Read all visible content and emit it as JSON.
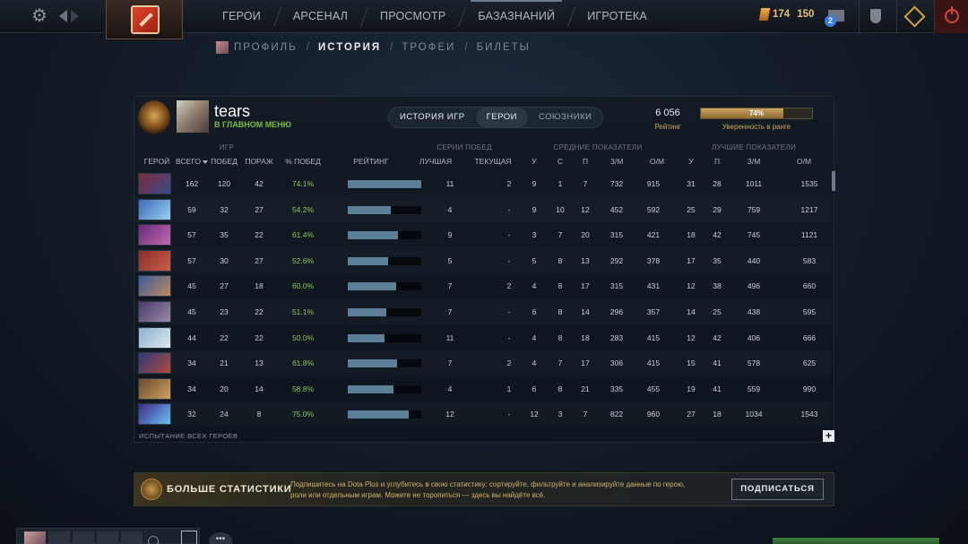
{
  "topbar": {
    "nav": [
      "ГЕРОИ",
      "АРСЕНАЛ",
      "ПРОСМОТР",
      "БАЗАЗНАНИЙ",
      "ИГРОТЕКА"
    ],
    "shards": "174",
    "shards2": "150",
    "mail_count": "2"
  },
  "subnav": {
    "items": [
      "ПРОФИЛЬ",
      "ИСТОРИЯ",
      "ТРОФЕИ",
      "БИЛЕТЫ"
    ],
    "active": "ИСТОРИЯ"
  },
  "profile": {
    "name": "tears",
    "status": "В ГЛАВНОМ МЕНЮ",
    "rating_value": "6 056",
    "rating_label": "Рейтинг",
    "confidence_value": "74%",
    "confidence_fraction": 0.74,
    "confidence_label": "Уверенность в ранге"
  },
  "tabs": [
    "ИСТОРИЯ ИГР",
    "ГЕРОИ",
    "СОЮЗНИКИ"
  ],
  "table": {
    "groups": {
      "games": "ИГР",
      "streaks": "СЕРИИ ПОБЕД",
      "averages": "СРЕДНИЕ ПОКАЗАТЕЛИ",
      "best": "ЛУЧШИЕ ПОКАЗАТЕЛИ"
    },
    "headers": {
      "hero": "ГЕРОЙ",
      "total": "ВСЕГО",
      "wins": "ПОБЕД",
      "losses": "ПОРАЖ",
      "winrate": "% ПОБЕД",
      "rating": "РЕЙТИНГ",
      "best": "ЛУЧШАЯ",
      "current": "ТЕКУЩАЯ",
      "avg_k": "У",
      "avg_d": "С",
      "avg_a": "П",
      "avg_gpm": "З/М",
      "avg_xpm": "О/М",
      "best_k": "У",
      "best_a": "П",
      "best_gpm": "З/М",
      "best_xpm": "О/М"
    },
    "rows": [
      {
        "total": "162",
        "wins": "120",
        "losses": "42",
        "winrate": "74.1%",
        "rating_fill": 1.0,
        "best": "11",
        "current": "2",
        "ak": "9",
        "ad": "1",
        "aa": "7",
        "agpm": "732",
        "axpm": "915",
        "bk": "31",
        "ba": "28",
        "bgpm": "1011",
        "bxpm": "1535",
        "colors": [
          "#7a2a3a",
          "#3a4a8a"
        ]
      },
      {
        "total": "59",
        "wins": "32",
        "losses": "27",
        "winrate": "54.2%",
        "rating_fill": 0.58,
        "best": "4",
        "current": "-",
        "ak": "9",
        "ad": "10",
        "aa": "12",
        "agpm": "452",
        "axpm": "592",
        "bk": "25",
        "ba": "29",
        "bgpm": "759",
        "bxpm": "1217",
        "colors": [
          "#3a6ab8",
          "#9ad0f0"
        ]
      },
      {
        "total": "57",
        "wins": "35",
        "losses": "22",
        "winrate": "61.4%",
        "rating_fill": 0.68,
        "best": "9",
        "current": "-",
        "ak": "3",
        "ad": "7",
        "aa": "20",
        "agpm": "315",
        "axpm": "421",
        "bk": "18",
        "ba": "42",
        "bgpm": "745",
        "bxpm": "1121",
        "colors": [
          "#6a2a7a",
          "#c06ab0"
        ]
      },
      {
        "total": "57",
        "wins": "30",
        "losses": "27",
        "winrate": "52.6%",
        "rating_fill": 0.55,
        "best": "5",
        "current": "-",
        "ak": "5",
        "ad": "8",
        "aa": "13",
        "agpm": "292",
        "axpm": "378",
        "bk": "17",
        "ba": "35",
        "bgpm": "440",
        "bxpm": "583",
        "colors": [
          "#8a2a2a",
          "#c8604a"
        ]
      },
      {
        "total": "45",
        "wins": "27",
        "losses": "18",
        "winrate": "60.0%",
        "rating_fill": 0.66,
        "best": "7",
        "current": "2",
        "ak": "4",
        "ad": "8",
        "aa": "17",
        "agpm": "315",
        "axpm": "431",
        "bk": "12",
        "ba": "38",
        "bgpm": "496",
        "bxpm": "660",
        "colors": [
          "#3a5a9a",
          "#c08a5a"
        ]
      },
      {
        "total": "45",
        "wins": "23",
        "losses": "22",
        "winrate": "51.1%",
        "rating_fill": 0.52,
        "best": "7",
        "current": "-",
        "ak": "6",
        "ad": "8",
        "aa": "14",
        "agpm": "296",
        "axpm": "357",
        "bk": "14",
        "ba": "25",
        "bgpm": "438",
        "bxpm": "595",
        "colors": [
          "#4a3a6a",
          "#9a8aa8"
        ]
      },
      {
        "total": "44",
        "wins": "22",
        "losses": "22",
        "winrate": "50.0%",
        "rating_fill": 0.5,
        "best": "11",
        "current": "-",
        "ak": "4",
        "ad": "8",
        "aa": "18",
        "agpm": "283",
        "axpm": "415",
        "bk": "12",
        "ba": "42",
        "bgpm": "406",
        "bxpm": "666",
        "colors": [
          "#8ab0d0",
          "#e0e8f0"
        ]
      },
      {
        "total": "34",
        "wins": "21",
        "losses": "13",
        "winrate": "61.8%",
        "rating_fill": 0.67,
        "best": "7",
        "current": "2",
        "ak": "4",
        "ad": "7",
        "aa": "17",
        "agpm": "306",
        "axpm": "415",
        "bk": "15",
        "ba": "41",
        "bgpm": "578",
        "bxpm": "625",
        "colors": [
          "#2a3a7a",
          "#b04a3a"
        ]
      },
      {
        "total": "34",
        "wins": "20",
        "losses": "14",
        "winrate": "58.8%",
        "rating_fill": 0.62,
        "best": "4",
        "current": "1",
        "ak": "6",
        "ad": "8",
        "aa": "21",
        "agpm": "335",
        "axpm": "455",
        "bk": "19",
        "ba": "41",
        "bgpm": "559",
        "bxpm": "990",
        "colors": [
          "#6a4a2a",
          "#d0a060"
        ]
      },
      {
        "total": "32",
        "wins": "24",
        "losses": "8",
        "winrate": "75.0%",
        "rating_fill": 0.83,
        "best": "12",
        "current": "-",
        "ak": "12",
        "ad": "3",
        "aa": "7",
        "agpm": "822",
        "axpm": "960",
        "bk": "27",
        "ba": "18",
        "bgpm": "1034",
        "bxpm": "1543",
        "colors": [
          "#3a2a8a",
          "#6ac0f0"
        ]
      }
    ],
    "footer_label": "ИСПЫТАНИЕ ВСЕХ ГЕРОЕВ"
  },
  "promo": {
    "title": "БОЛЬШЕ СТАТИСТИКИ",
    "description": "Подпишитесь на Dota Plus и углубитесь в свою статистику: сортируйте, фильтруйте и анализируйте данные по герою, роли или отдельным играм. Можете не торопиться — здесь вы найдёте всё.",
    "button": "ПОДПИСАТЬСЯ"
  },
  "bottom": {
    "chat_label": "•••"
  }
}
